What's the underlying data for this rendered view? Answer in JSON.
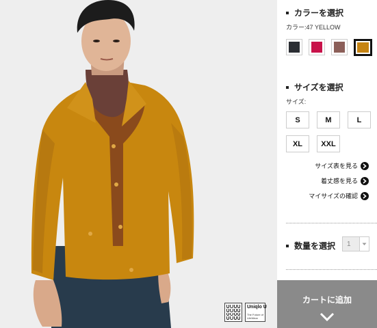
{
  "product_photo": {
    "alt_colors": {
      "background": "#eeeeee",
      "jacket": "#c8870f",
      "turtleneck": "#6a4038",
      "sweater": "#8a4a1c",
      "pants": "#283b4c"
    },
    "badges": [
      {
        "name": "uuu-logo"
      },
      {
        "name": "uniqlo-u-logo",
        "line1": "Uniqlo U",
        "line2": "The Future of LifeWear"
      }
    ]
  },
  "color_section": {
    "title": "カラーを選択",
    "selected_label": "カラー:47 YELLOW",
    "swatches": [
      {
        "name": "black",
        "color": "#2b2e33",
        "selected": false
      },
      {
        "name": "red",
        "color": "#c8124a",
        "selected": false
      },
      {
        "name": "brown",
        "color": "#8c5f59",
        "selected": false
      },
      {
        "name": "yellow",
        "color": "#c68413",
        "selected": true
      }
    ]
  },
  "size_section": {
    "title": "サイズを選択",
    "label": "サイズ:",
    "row1": [
      "S",
      "M",
      "L"
    ],
    "row2": [
      "XL",
      "XXL"
    ]
  },
  "links": {
    "size_chart": "サイズ表を見る",
    "fit": "着丈感を見る",
    "my_size": "マイサイズの確認"
  },
  "quantity_section": {
    "title": "数量を選択",
    "value": "1"
  },
  "cart_button": {
    "label": "カートに追加"
  }
}
